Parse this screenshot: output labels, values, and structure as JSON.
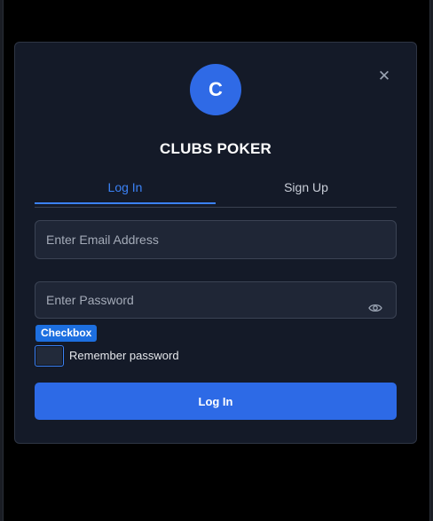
{
  "modal": {
    "close_icon": "close-icon",
    "logo_letter": "C",
    "brand": "CLUBS POKER",
    "tabs": [
      {
        "label": "Log In",
        "active": true
      },
      {
        "label": "Sign Up",
        "active": false
      }
    ],
    "email": {
      "placeholder": "Enter Email Address",
      "value": ""
    },
    "password": {
      "placeholder": "Enter Password",
      "value": "",
      "toggle_icon": "eye-icon"
    },
    "checkbox_badge": "Checkbox",
    "remember_label": "Remember password",
    "remember_checked": false,
    "submit_label": "Log In"
  },
  "colors": {
    "accent": "#2d6ae6",
    "active_tab": "#3b82f6",
    "modal_bg": "#141a28",
    "input_bg": "#1f2636"
  }
}
